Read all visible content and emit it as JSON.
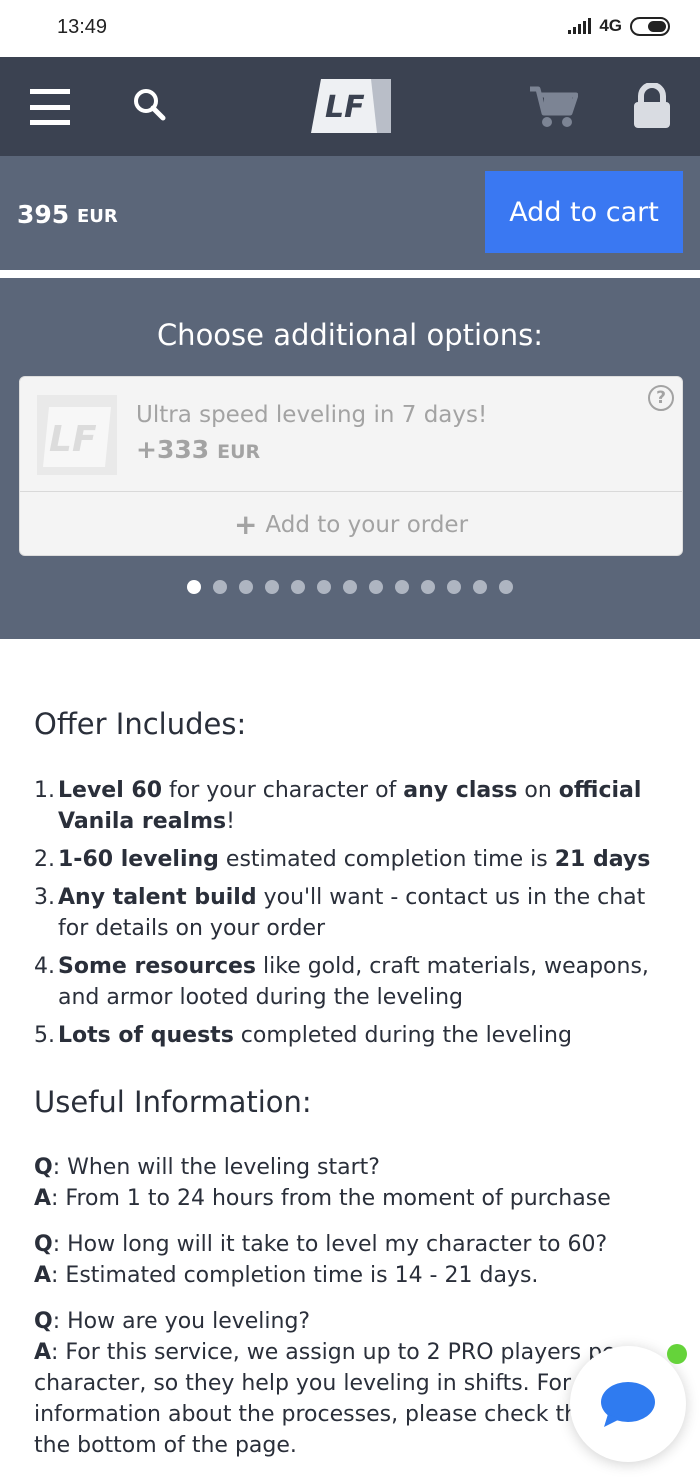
{
  "status": {
    "time": "13:49",
    "network": "4G"
  },
  "header": {
    "logo_text": "LF",
    "icons": [
      "menu-icon",
      "search-icon",
      "cart-icon",
      "lock-icon"
    ]
  },
  "price": {
    "value": "395",
    "currency": "EUR",
    "cta": "Add to cart"
  },
  "options": {
    "title": "Choose additional options:",
    "card": {
      "name": "Ultra speed leveling in 7 days!",
      "price": "+333",
      "currency": "EUR",
      "help": "?",
      "add_label": "Add to your order"
    },
    "slides_total": 13,
    "active_slide": 1
  },
  "offer": {
    "title": "Offer Includes:",
    "items": [
      {
        "num": "1.",
        "parts": [
          {
            "b": "Level 60"
          },
          {
            "t": " for your character of "
          },
          {
            "b": "any class"
          },
          {
            "t": " on "
          },
          {
            "b": "official Vanila realms"
          },
          {
            "t": "!"
          }
        ]
      },
      {
        "num": "2.",
        "parts": [
          {
            "b": "1-60 leveling"
          },
          {
            "t": " estimated completion time is "
          },
          {
            "b": "21 days"
          }
        ]
      },
      {
        "num": "3.",
        "parts": [
          {
            "b": "Any talent build"
          },
          {
            "t": " you'll want - contact us in the chat for details on your order"
          }
        ]
      },
      {
        "num": "4.",
        "parts": [
          {
            "b": "Some resources"
          },
          {
            "t": " like gold, craft materials, weapons, and armor looted during the leveling"
          }
        ]
      },
      {
        "num": "5.",
        "parts": [
          {
            "b": "Lots of quests"
          },
          {
            "t": " completed during the leveling"
          }
        ]
      }
    ]
  },
  "info": {
    "title": "Useful Information:",
    "q_label": "Q",
    "a_label": "A",
    "qa": [
      {
        "q": ": When will the leveling start?",
        "a": ": From 1 to 24 hours from the moment of purchase"
      },
      {
        "q": ": How long will it take to level my character to 60?",
        "a": ": Estimated completion time is 14 - 21 days."
      },
      {
        "q": ": How are you leveling?",
        "a": ": For this service, we assign up to 2 PRO players per character, so they help you leveling in shifts. For more information about the processes, please check the FAQ at the bottom of the page."
      }
    ]
  },
  "chat": {
    "icon": "chat-bubble-icon",
    "status_color": "#65d33a"
  },
  "colors": {
    "header": "#3b4251",
    "panel": "#5b6679",
    "accent": "#3a78f2"
  }
}
